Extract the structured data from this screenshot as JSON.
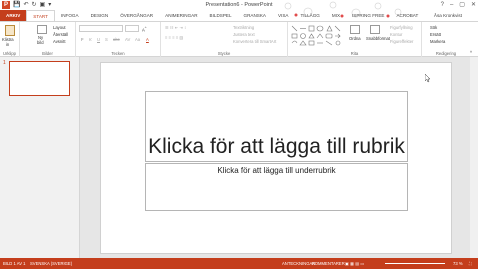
{
  "window": {
    "title": "Presentation6 - PowerPoint",
    "qat_logo": "P",
    "controls": [
      "?",
      "–",
      "▢",
      "✕"
    ]
  },
  "tabs": [
    {
      "label": "ARKIV"
    },
    {
      "label": "START"
    },
    {
      "label": "INFOGA"
    },
    {
      "label": "DESIGN"
    },
    {
      "label": "ÖVERGÅNGAR"
    },
    {
      "label": "ANIMERINGAR"
    },
    {
      "label": "BILDSPEL"
    },
    {
      "label": "GRANSKA"
    },
    {
      "label": "VISA"
    },
    {
      "label": "TILLÄGG"
    },
    {
      "label": "MIX"
    },
    {
      "label": "ISPRING FREE"
    },
    {
      "label": "ACROBAT"
    }
  ],
  "user": "Åsa Kronkvist",
  "ribbon": {
    "clipboard": {
      "paste": "Klistra",
      "paste2": "in",
      "label": "Urklipp"
    },
    "slides": {
      "new": "Ny",
      "new2": "bild",
      "layout": "Layout",
      "reset": "Återställ",
      "section": "Avsnitt",
      "label": "Bilder"
    },
    "font": {
      "label": "Tecken",
      "bold": "F",
      "italic": "K",
      "underline": "U",
      "strike": "S",
      "shadow": "abc",
      "spacing": "AV",
      "case": "Aa",
      "color": "A"
    },
    "paragraph": {
      "label": "Stycke",
      "textdir": "Textriktning",
      "align": "Justera text",
      "smartart": "Konvertera till SmartArt"
    },
    "drawing": {
      "label": "Rita",
      "arrange": "Ordna",
      "quickstyles": "Snabbformat",
      "fill": "Figurfyllning",
      "outline": "Kontur",
      "effects": "Figureffekter"
    },
    "editing": {
      "label": "Redigering",
      "find": "Sök",
      "replace": "Ersätt",
      "select": "Markera"
    }
  },
  "slide_pane": {
    "number": "1"
  },
  "slide": {
    "title_placeholder": "Klicka för att lägga till rubrik",
    "subtitle_placeholder": "Klicka för att lägga till underrubrik"
  },
  "statusbar": {
    "slide_info": "BILD 1 AV 1",
    "language": "SVENSKA (SVERIGE)",
    "notes": "ANTECKNINGAR",
    "comments": "KOMMENTARER",
    "zoom": "73 %"
  },
  "colors": {
    "accent": "#c43e1c"
  }
}
